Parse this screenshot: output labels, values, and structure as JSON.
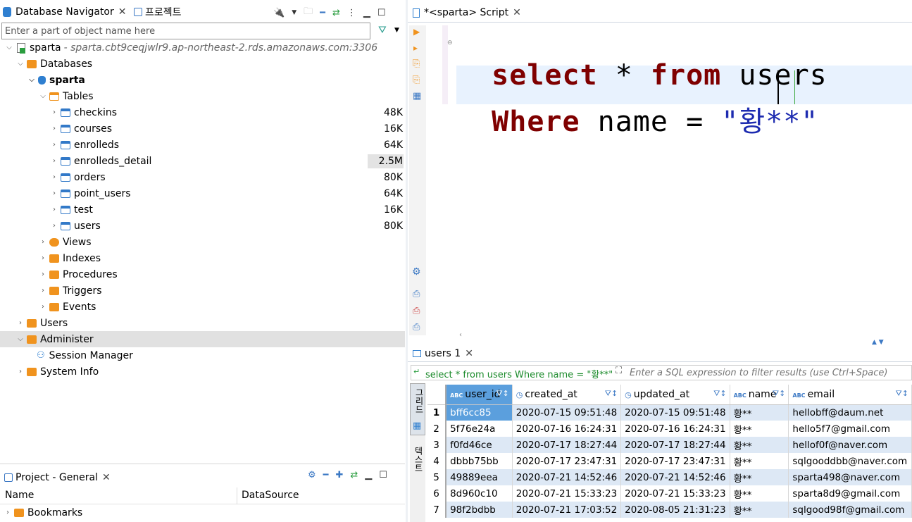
{
  "navigator": {
    "tab_title": "Database Navigator",
    "tab2_title": "프로젝트",
    "filter_placeholder": "Enter a part of object name here",
    "connection": {
      "name": "sparta",
      "host": " - sparta.cbt9ceqjwlr9.ap-northeast-2.rds.amazonaws.com:3306"
    },
    "databases_label": "Databases",
    "db_name": "sparta",
    "tables_label": "Tables",
    "tables": [
      {
        "name": "checkins",
        "size": "48K"
      },
      {
        "name": "courses",
        "size": "16K"
      },
      {
        "name": "enrolleds",
        "size": "64K"
      },
      {
        "name": "enrolleds_detail",
        "size": "2.5M"
      },
      {
        "name": "orders",
        "size": "80K"
      },
      {
        "name": "point_users",
        "size": "64K"
      },
      {
        "name": "test",
        "size": "16K"
      },
      {
        "name": "users",
        "size": "80K"
      }
    ],
    "folders": [
      "Views",
      "Indexes",
      "Procedures",
      "Triggers",
      "Events"
    ],
    "users_label": "Users",
    "administer_label": "Administer",
    "session_manager_label": "Session Manager",
    "system_info_label": "System Info"
  },
  "project": {
    "tab_title": "Project - General",
    "col_name": "Name",
    "col_datasource": "DataSource",
    "bookmarks_label": "Bookmarks"
  },
  "editor": {
    "tab_title": "*<sparta> Script",
    "line1": {
      "kw1": "select",
      "rest1": " * ",
      "kw2": "from",
      "rest2": " users"
    },
    "line2": {
      "kw": "Where",
      "rest": " name = ",
      "str": "\"황**\""
    }
  },
  "results": {
    "tab_title": "users 1",
    "query_text": "select * from users Where name = \"황**\"",
    "filter_placeholder": "Enter a SQL expression to filter results (use Ctrl+Space)",
    "side_tab1": "그리드",
    "side_tab2": "텍스트",
    "columns": [
      "user_id",
      "created_at",
      "updated_at",
      "name",
      "email"
    ],
    "rows": [
      [
        "1",
        "bff6cc85",
        "2020-07-15 09:51:48",
        "2020-07-15 09:51:48",
        "황**",
        "hellobff@daum.net"
      ],
      [
        "2",
        "5f76e24a",
        "2020-07-16 16:24:31",
        "2020-07-16 16:24:31",
        "황**",
        "hello5f7@gmail.com"
      ],
      [
        "3",
        "f0fd46ce",
        "2020-07-17 18:27:44",
        "2020-07-17 18:27:44",
        "황**",
        "hellof0f@naver.com"
      ],
      [
        "4",
        "dbbb75bb",
        "2020-07-17 23:47:31",
        "2020-07-17 23:47:31",
        "황**",
        "sqlgooddbb@naver.com"
      ],
      [
        "5",
        "49889eea",
        "2020-07-21 14:52:46",
        "2020-07-21 14:52:46",
        "황**",
        "sparta498@naver.com"
      ],
      [
        "6",
        "8d960c10",
        "2020-07-21 15:33:23",
        "2020-07-21 15:33:23",
        "황**",
        "sparta8d9@gmail.com"
      ],
      [
        "7",
        "98f2bdbb",
        "2020-07-21 17:03:52",
        "2020-08-05 21:31:23",
        "황**",
        "sqlgood98f@gmail.com"
      ]
    ]
  },
  "colors": {
    "accent": "#3b78c4",
    "keyword": "#7f0000",
    "string": "#1d2bb0",
    "row_alt": "#dde8f5"
  }
}
